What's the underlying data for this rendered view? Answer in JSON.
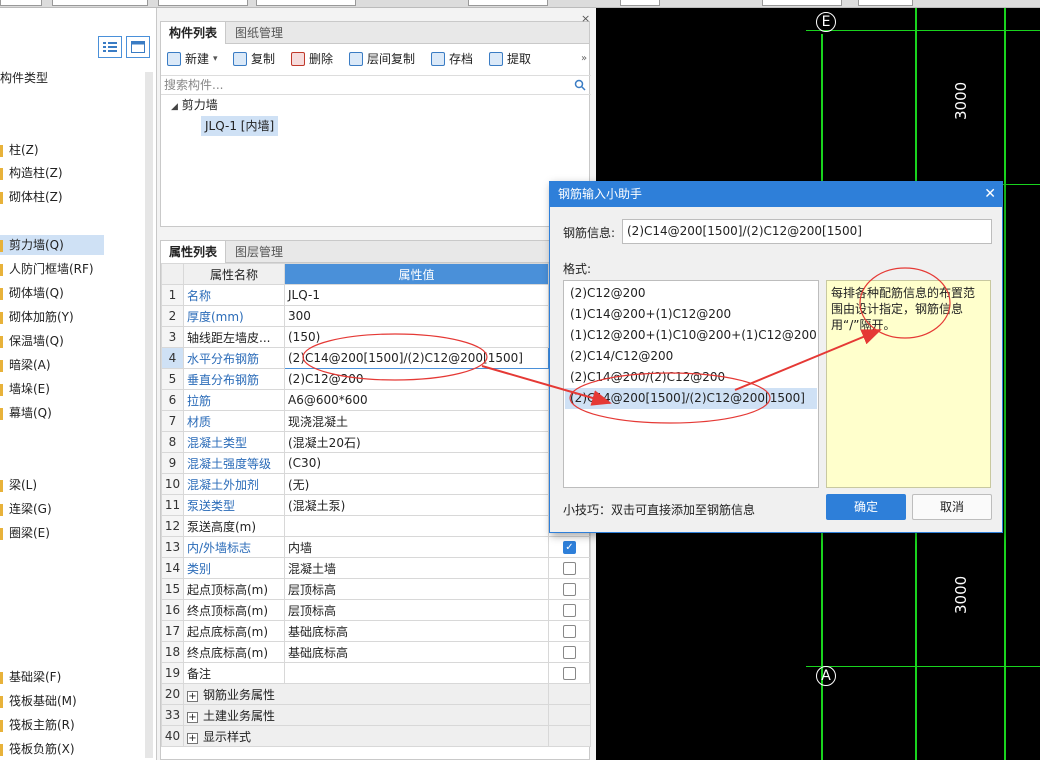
{
  "left_panel": {
    "items": [
      {
        "label": "构件类型"
      },
      {
        "label": "柱(Z)"
      },
      {
        "label": "构造柱(Z)"
      },
      {
        "label": "砌体柱(Z)"
      },
      {
        "label": "剪力墙(Q)"
      },
      {
        "label": "人防门框墙(RF)"
      },
      {
        "label": "砌体墙(Q)"
      },
      {
        "label": "砌体加筋(Y)"
      },
      {
        "label": "保温墙(Q)"
      },
      {
        "label": "暗梁(A)"
      },
      {
        "label": "墙垛(E)"
      },
      {
        "label": "幕墙(Q)"
      },
      {
        "label": "梁(L)"
      },
      {
        "label": "连梁(G)"
      },
      {
        "label": "圈梁(E)"
      },
      {
        "label": "基础梁(F)"
      },
      {
        "label": "筏板基础(M)"
      },
      {
        "label": "筏板主筋(R)"
      },
      {
        "label": "筏板负筋(X)"
      }
    ]
  },
  "component_panel": {
    "tabs": [
      "构件列表",
      "图纸管理"
    ],
    "toolbar": {
      "new": "新建",
      "copy": "复制",
      "delete": "删除",
      "floor_copy": "层间复制",
      "save": "存档",
      "extract": "提取"
    },
    "search_placeholder": "搜索构件...",
    "tree_parent": "剪力墙",
    "tree_child": "JLQ-1 [内墙]"
  },
  "property_panel": {
    "tabs": [
      "属性列表",
      "图层管理"
    ],
    "col_name": "属性名称",
    "col_value": "属性值",
    "rows": [
      {
        "no": "1",
        "name": "名称",
        "value": "JLQ-1"
      },
      {
        "no": "2",
        "name": "厚度(mm)",
        "value": "300"
      },
      {
        "no": "3",
        "name": "轴线距左墙皮...",
        "value": "(150)"
      },
      {
        "no": "4",
        "name": "水平分布钢筋",
        "value": "(2)C14@200[1500]/(2)C12@200[1500]"
      },
      {
        "no": "5",
        "name": "垂直分布钢筋",
        "value": "(2)C12@200"
      },
      {
        "no": "6",
        "name": "拉筋",
        "value": "A6@600*600"
      },
      {
        "no": "7",
        "name": "材质",
        "value": "现浇混凝土"
      },
      {
        "no": "8",
        "name": "混凝土类型",
        "value": "(混凝土20石)"
      },
      {
        "no": "9",
        "name": "混凝土强度等级",
        "value": "(C30)"
      },
      {
        "no": "10",
        "name": "混凝土外加剂",
        "value": "(无)"
      },
      {
        "no": "11",
        "name": "泵送类型",
        "value": "(混凝土泵)"
      },
      {
        "no": "12",
        "name": "泵送高度(m)",
        "value": ""
      },
      {
        "no": "13",
        "name": "内/外墙标志",
        "value": "内墙"
      },
      {
        "no": "14",
        "name": "类别",
        "value": "混凝土墙"
      },
      {
        "no": "15",
        "name": "起点顶标高(m)",
        "value": "层顶标高"
      },
      {
        "no": "16",
        "name": "终点顶标高(m)",
        "value": "层顶标高"
      },
      {
        "no": "17",
        "name": "起点底标高(m)",
        "value": "基础底标高"
      },
      {
        "no": "18",
        "name": "终点底标高(m)",
        "value": "基础底标高"
      },
      {
        "no": "19",
        "name": "备注",
        "value": ""
      }
    ],
    "groups": [
      {
        "no": "20",
        "name": "钢筋业务属性"
      },
      {
        "no": "33",
        "name": "土建业务属性"
      },
      {
        "no": "40",
        "name": "显示样式"
      }
    ]
  },
  "cad": {
    "dim_top": "3000",
    "dim_bottom": "3000",
    "axis_top": "E",
    "axis_bottom": "A"
  },
  "dialog": {
    "title": "钢筋输入小助手",
    "info_label": "钢筋信息:",
    "info_value": "(2)C14@200[1500]/(2)C12@200[1500]",
    "format_label": "格式:",
    "formats": [
      "(2)C12@200",
      "(1)C14@200+(1)C12@200",
      "(1)C12@200+(1)C10@200+(1)C12@200",
      "(2)C14/C12@200",
      "(2)C14@200/(2)C12@200",
      "(2)C14@200[1500]/(2)C12@200[1500]"
    ],
    "note": "每排各种配筋信息的布置范围由设计指定，钢筋信息用“/”隔开。",
    "tip": "小技巧：双击可直接添加至钢筋信息",
    "ok": "确定",
    "cancel": "取消"
  },
  "colors": {
    "accent": "#2e7fd9",
    "annotation": "#e53935",
    "grid": "#19d31e",
    "note_bg": "#ffffcc"
  }
}
